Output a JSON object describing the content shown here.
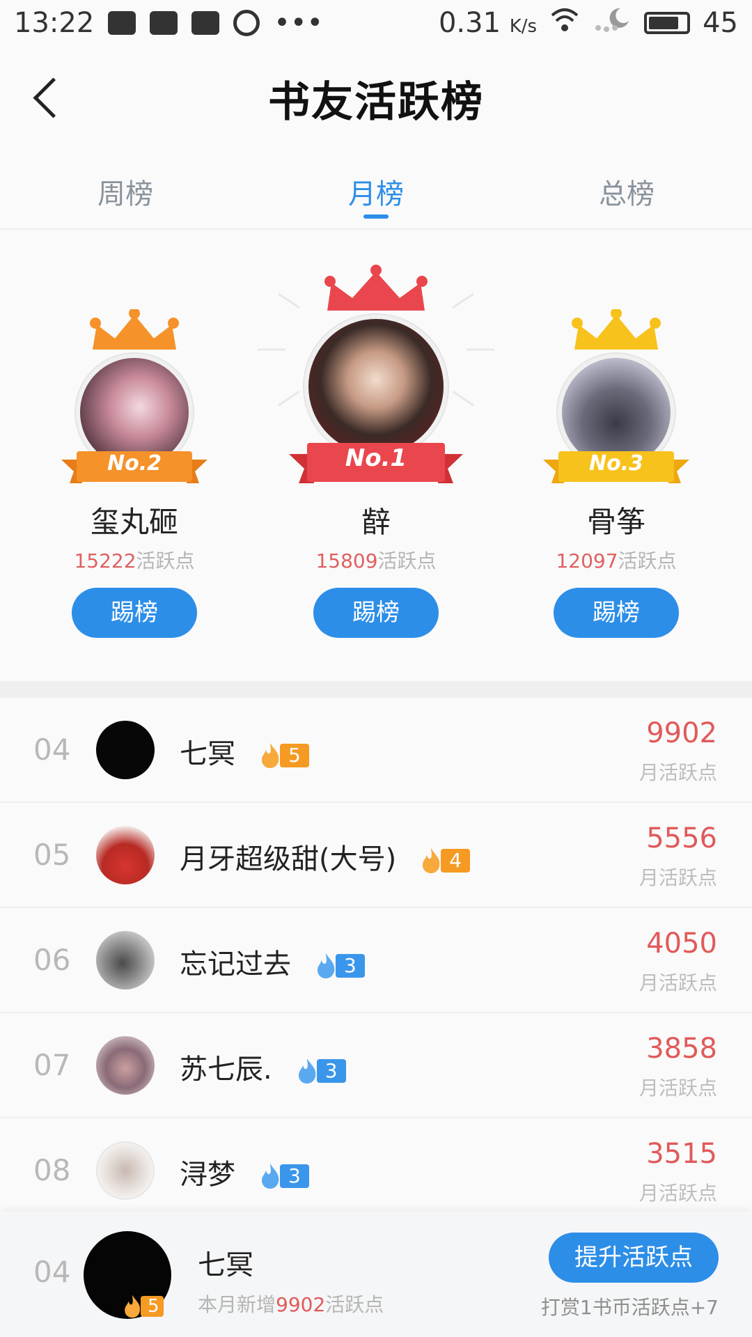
{
  "status_bar": {
    "time": "13:22",
    "speed": "0.31",
    "speed_unit": "K/s",
    "battery": "45",
    "battery_level_percent": 65
  },
  "header": {
    "title": "书友活跃榜"
  },
  "tabs": [
    {
      "label": "周榜",
      "active": false
    },
    {
      "label": "月榜",
      "active": true
    },
    {
      "label": "总榜",
      "active": false
    }
  ],
  "podium": {
    "first": {
      "rank_label": "No.1",
      "name": "辪",
      "points": "15809",
      "points_unit": "活跃点",
      "button": "踢榜"
    },
    "second": {
      "rank_label": "No.2",
      "name": "玺丸砸",
      "points": "15222",
      "points_unit": "活跃点",
      "button": "踢榜"
    },
    "third": {
      "rank_label": "No.3",
      "name": "骨筝",
      "points": "12097",
      "points_unit": "活跃点",
      "button": "踢榜"
    }
  },
  "colors": {
    "accent": "#2d8ee8",
    "value_red": "#e05a5a",
    "level_orange": "#f59a23",
    "level_blue": "#3a96ea"
  },
  "list": [
    {
      "rank": "04",
      "name": "七冥",
      "level": "5",
      "level_color": "orange",
      "value": "9902",
      "unit": "月活跃点"
    },
    {
      "rank": "05",
      "name": "月牙超级甜(大号)",
      "level": "4",
      "level_color": "orange",
      "value": "5556",
      "unit": "月活跃点"
    },
    {
      "rank": "06",
      "name": "忘记过去",
      "level": "3",
      "level_color": "blue",
      "value": "4050",
      "unit": "月活跃点"
    },
    {
      "rank": "07",
      "name": "苏七辰.",
      "level": "3",
      "level_color": "blue",
      "value": "3858",
      "unit": "月活跃点"
    },
    {
      "rank": "08",
      "name": "浔梦",
      "level": "3",
      "level_color": "blue",
      "value": "3515",
      "unit": "月活跃点"
    }
  ],
  "my_rank": {
    "rank": "04",
    "name": "七冥",
    "level": "5",
    "sub_prefix": "本月新增",
    "sub_value": "9902",
    "sub_suffix": "活跃点",
    "button": "提升活跃点",
    "hint": "打赏1书币活跃点+7"
  }
}
